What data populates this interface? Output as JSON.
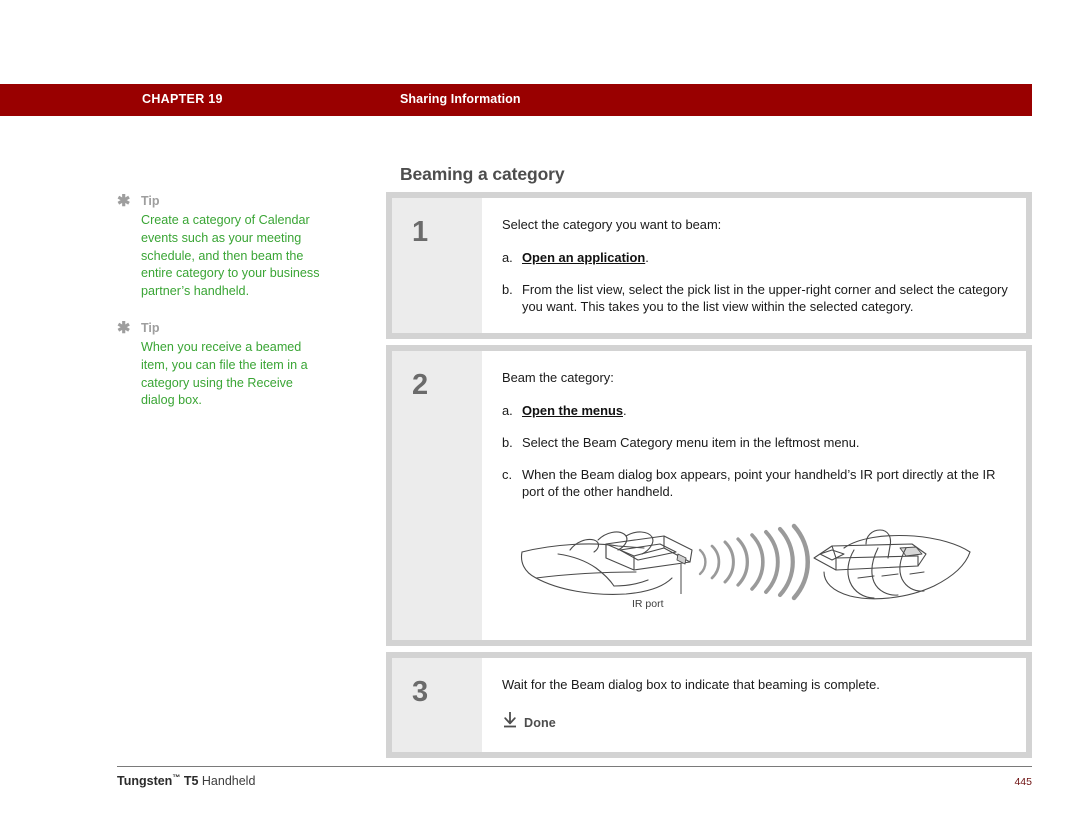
{
  "header": {
    "chapter": "CHAPTER 19",
    "section": "Sharing Information",
    "bar_color": "#990000"
  },
  "page_heading": "Beaming a category",
  "sidebar": {
    "tips": [
      {
        "icon": "asterisk-icon",
        "label": "Tip",
        "body": "Create a category of Calendar events such as your meeting schedule, and then beam the entire category to your business partner’s handheld."
      },
      {
        "icon": "asterisk-icon",
        "label": "Tip",
        "body": "When you receive a beamed item, you can file the item in a category using the Receive dialog box."
      }
    ],
    "tip_text_color": "#3aa535",
    "tip_label_color": "#9e9e9e"
  },
  "steps": [
    {
      "number": "1",
      "lead": "Select the category you want to beam:",
      "substeps": [
        {
          "marker": "a.",
          "link_text": "Open an application",
          "text_after": "."
        },
        {
          "marker": "b.",
          "text": "From the list view, select the pick list in the upper-right corner and select the category you want. This takes you to the list view within the selected category."
        }
      ]
    },
    {
      "number": "2",
      "lead": "Beam the category:",
      "substeps": [
        {
          "marker": "a.",
          "link_text": "Open the menus",
          "text_after": "."
        },
        {
          "marker": "b.",
          "text": "Select the Beam Category menu item in the leftmost menu."
        },
        {
          "marker": "c.",
          "text": "When the Beam dialog box appears, point your handheld’s IR port directly at the IR port of the other handheld."
        }
      ],
      "illustration": {
        "name": "beaming-handhelds-diagram",
        "callout_label": "IR port"
      }
    },
    {
      "number": "3",
      "lead": "Wait for the Beam dialog box to indicate that beaming is complete.",
      "done": {
        "icon": "down-arrow-to-bar-icon",
        "label": "Done"
      }
    }
  ],
  "footer": {
    "product_brand": "Tungsten",
    "product_tm": "™",
    "product_model": "T5",
    "product_type": "Handheld",
    "page_number": "445"
  }
}
